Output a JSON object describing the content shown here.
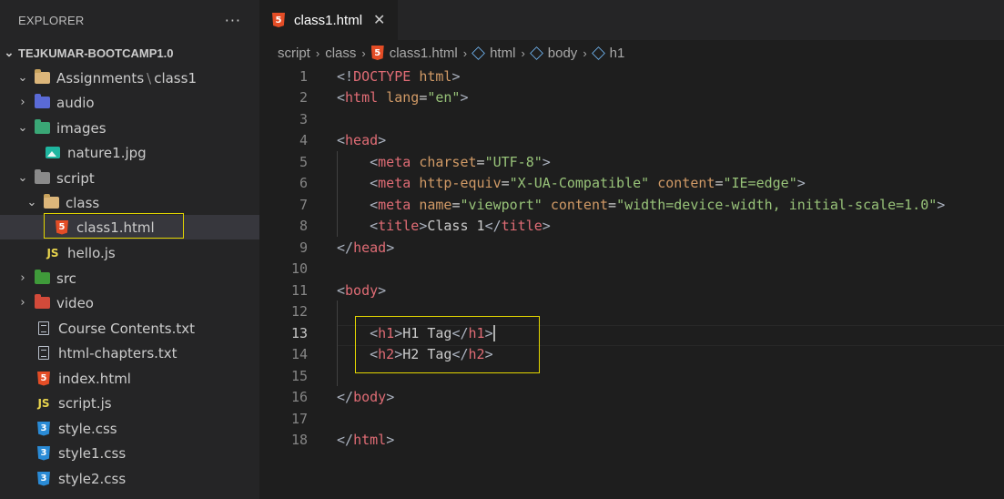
{
  "sidebar": {
    "title": "EXPLORER",
    "more": "···",
    "workspace": "TEJKUMAR-BOOTCAMP1.0",
    "items": [
      {
        "label": "Assignments",
        "label2": "class1",
        "sep": "\\"
      },
      {
        "label": "audio"
      },
      {
        "label": "images"
      },
      {
        "label": "nature1.jpg"
      },
      {
        "label": "script"
      },
      {
        "label": "class"
      },
      {
        "label": "class1.html"
      },
      {
        "label": "hello.js"
      },
      {
        "label": "src"
      },
      {
        "label": "video"
      },
      {
        "label": "Course Contents.txt"
      },
      {
        "label": "html-chapters.txt"
      },
      {
        "label": "index.html"
      },
      {
        "label": "script.js"
      },
      {
        "label": "style.css"
      },
      {
        "label": "style1.css"
      },
      {
        "label": "style2.css"
      }
    ]
  },
  "tab": {
    "label": "class1.html",
    "close": "✕"
  },
  "breadcrumb": {
    "items": [
      "script",
      "class",
      "class1.html",
      "html",
      "body",
      "h1"
    ],
    "sep": "›"
  },
  "code": {
    "line_numbers": [
      "1",
      "2",
      "3",
      "4",
      "5",
      "6",
      "7",
      "8",
      "9",
      "10",
      "11",
      "12",
      "13",
      "14",
      "15",
      "16",
      "17",
      "18"
    ],
    "lines": [
      [
        [
          "p",
          "<!"
        ],
        [
          "t",
          "DOCTYPE"
        ],
        [
          "p",
          " "
        ],
        [
          "a",
          "html"
        ],
        [
          "p",
          ">"
        ]
      ],
      [
        [
          "p",
          "<"
        ],
        [
          "t",
          "html"
        ],
        [
          "x",
          " "
        ],
        [
          "a",
          "lang"
        ],
        [
          "x",
          "="
        ],
        [
          "s",
          "\"en\""
        ],
        [
          "p",
          ">"
        ]
      ],
      [],
      [
        [
          "p",
          "<"
        ],
        [
          "t",
          "head"
        ],
        [
          "p",
          ">"
        ]
      ],
      [
        [
          "x",
          "    "
        ],
        [
          "p",
          "<"
        ],
        [
          "t",
          "meta"
        ],
        [
          "x",
          " "
        ],
        [
          "a",
          "charset"
        ],
        [
          "x",
          "="
        ],
        [
          "s",
          "\"UTF-8\""
        ],
        [
          "p",
          ">"
        ]
      ],
      [
        [
          "x",
          "    "
        ],
        [
          "p",
          "<"
        ],
        [
          "t",
          "meta"
        ],
        [
          "x",
          " "
        ],
        [
          "a",
          "http-equiv"
        ],
        [
          "x",
          "="
        ],
        [
          "s",
          "\"X-UA-Compatible\""
        ],
        [
          "x",
          " "
        ],
        [
          "a",
          "content"
        ],
        [
          "x",
          "="
        ],
        [
          "s",
          "\"IE=edge\""
        ],
        [
          "p",
          ">"
        ]
      ],
      [
        [
          "x",
          "    "
        ],
        [
          "p",
          "<"
        ],
        [
          "t",
          "meta"
        ],
        [
          "x",
          " "
        ],
        [
          "a",
          "name"
        ],
        [
          "x",
          "="
        ],
        [
          "s",
          "\"viewport\""
        ],
        [
          "x",
          " "
        ],
        [
          "a",
          "content"
        ],
        [
          "x",
          "="
        ],
        [
          "s",
          "\"width=device-width, initial-scale=1.0\""
        ],
        [
          "p",
          ">"
        ]
      ],
      [
        [
          "x",
          "    "
        ],
        [
          "p",
          "<"
        ],
        [
          "t",
          "title"
        ],
        [
          "p",
          ">"
        ],
        [
          "x",
          "Class 1"
        ],
        [
          "p",
          "</"
        ],
        [
          "t",
          "title"
        ],
        [
          "p",
          ">"
        ]
      ],
      [
        [
          "p",
          "</"
        ],
        [
          "t",
          "head"
        ],
        [
          "p",
          ">"
        ]
      ],
      [],
      [
        [
          "p",
          "<"
        ],
        [
          "t",
          "body"
        ],
        [
          "p",
          ">"
        ]
      ],
      [],
      [
        [
          "x",
          "    "
        ],
        [
          "p",
          "<"
        ],
        [
          "t",
          "h1"
        ],
        [
          "p",
          ">"
        ],
        [
          "x",
          "H1 Tag"
        ],
        [
          "p",
          "</"
        ],
        [
          "t",
          "h1"
        ],
        [
          "p",
          ">"
        ]
      ],
      [
        [
          "x",
          "    "
        ],
        [
          "p",
          "<"
        ],
        [
          "t",
          "h2"
        ],
        [
          "p",
          ">"
        ],
        [
          "x",
          "H2 Tag"
        ],
        [
          "p",
          "</"
        ],
        [
          "t",
          "h2"
        ],
        [
          "p",
          ">"
        ]
      ],
      [],
      [
        [
          "p",
          "</"
        ],
        [
          "t",
          "body"
        ],
        [
          "p",
          ">"
        ]
      ],
      [],
      [
        [
          "p",
          "</"
        ],
        [
          "t",
          "html"
        ],
        [
          "p",
          ">"
        ]
      ]
    ],
    "current_line": 13
  },
  "colors": {
    "tag": "#e06c75",
    "punct": "#abb2bf",
    "attr": "#d19a66",
    "string": "#98c379",
    "text": "#cccccc",
    "highlight_box": "#e3d600"
  }
}
